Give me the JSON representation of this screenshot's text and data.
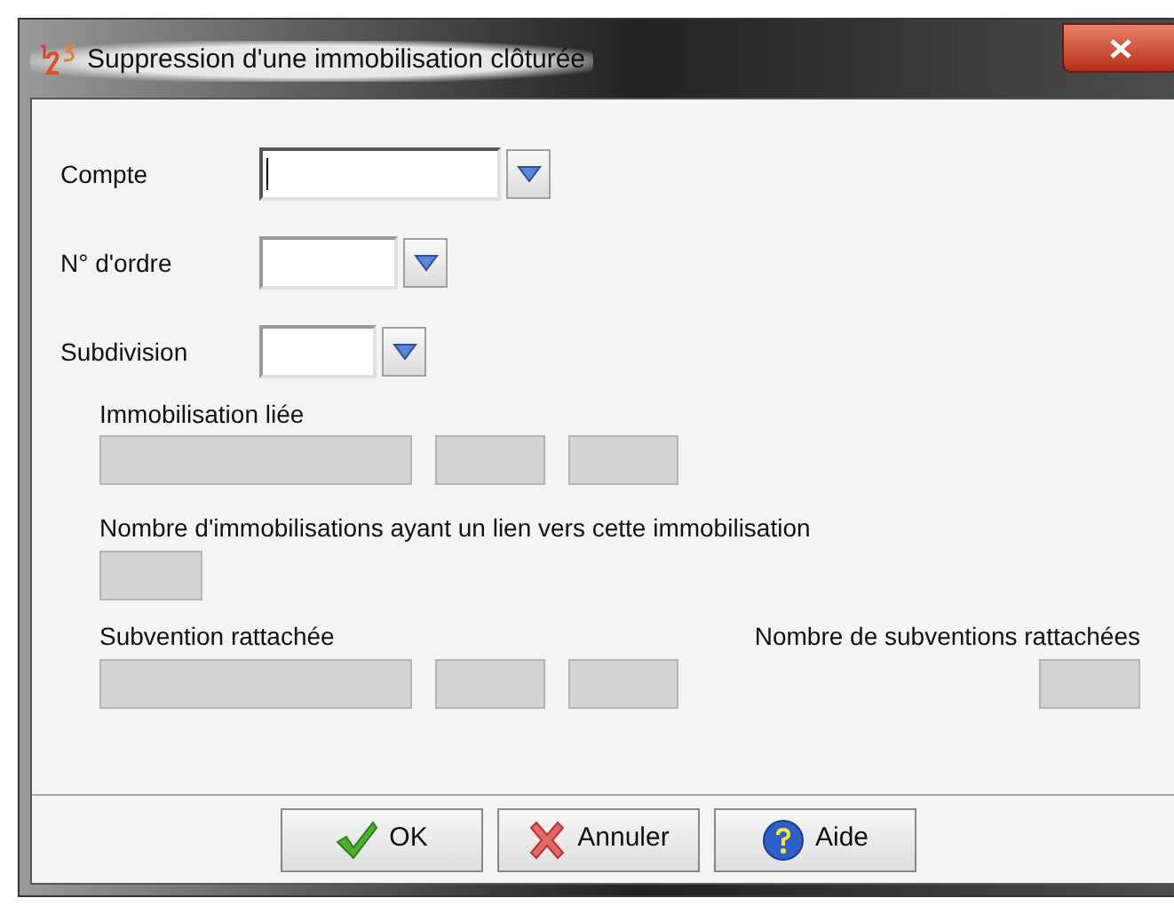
{
  "window": {
    "title": "Suppression d'une immobilisation clôturée"
  },
  "combos": [
    {
      "label": "Compte",
      "focused": true
    },
    {
      "label": "N° d'ordre",
      "focused": false
    },
    {
      "label": "Subdivision",
      "focused": false
    }
  ],
  "linked_asset": {
    "label": "Immobilisation liée"
  },
  "linked_count": {
    "label": "Nombre d'immobilisations ayant un lien vers cette immobilisation"
  },
  "subsidy": {
    "label": "Subvention rattachée",
    "count_label": "Nombre de subventions rattachées"
  },
  "buttons": [
    {
      "label": "OK",
      "kind": "ok"
    },
    {
      "label": "Annuler",
      "kind": "cancel"
    },
    {
      "label": "Aide",
      "kind": "help"
    }
  ]
}
